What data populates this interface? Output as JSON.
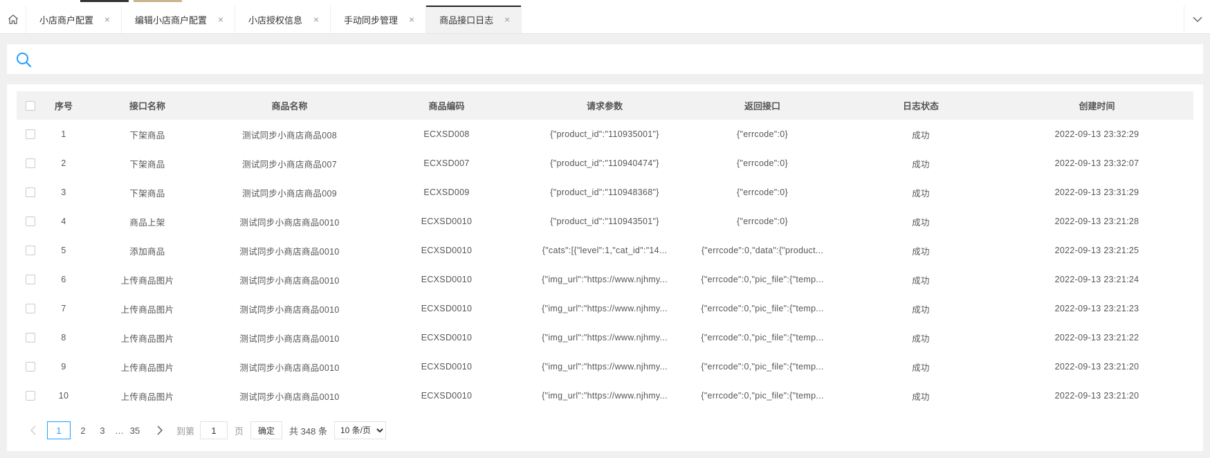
{
  "tabs": [
    {
      "label": "小店商户配置",
      "close": "×",
      "active": false
    },
    {
      "label": "编辑小店商户配置",
      "close": "×",
      "active": false
    },
    {
      "label": "小店授权信息",
      "close": "×",
      "active": false
    },
    {
      "label": "手动同步管理",
      "close": "×",
      "active": false
    },
    {
      "label": "商品接口日志",
      "close": "×",
      "active": true
    }
  ],
  "icons": {
    "home": "home-icon",
    "more": "chevron-down-icon",
    "search": "search-icon",
    "prev": "chevron-left-icon",
    "next": "chevron-right-icon"
  },
  "colors": {
    "accent": "#1e9fff",
    "active_tab_line": "#222222"
  },
  "table": {
    "headers": [
      "序号",
      "接口名称",
      "商品名称",
      "商品编码",
      "请求参数",
      "返回接口",
      "日志状态",
      "创建时间"
    ],
    "rows": [
      [
        "1",
        "下架商品",
        "测试同步小商店商品008",
        "ECXSD008",
        "{\"product_id\":\"110935001\"}",
        "{\"errcode\":0}",
        "成功",
        "2022-09-13 23:32:29"
      ],
      [
        "2",
        "下架商品",
        "测试同步小商店商品007",
        "ECXSD007",
        "{\"product_id\":\"110940474\"}",
        "{\"errcode\":0}",
        "成功",
        "2022-09-13 23:32:07"
      ],
      [
        "3",
        "下架商品",
        "测试同步小商店商品009",
        "ECXSD009",
        "{\"product_id\":\"110948368\"}",
        "{\"errcode\":0}",
        "成功",
        "2022-09-13 23:31:29"
      ],
      [
        "4",
        "商品上架",
        "测试同步小商店商品0010",
        "ECXSD0010",
        "{\"product_id\":\"110943501\"}",
        "{\"errcode\":0}",
        "成功",
        "2022-09-13 23:21:28"
      ],
      [
        "5",
        "添加商品",
        "测试同步小商店商品0010",
        "ECXSD0010",
        "{\"cats\":[{\"level\":1,\"cat_id\":\"14...",
        "{\"errcode\":0,\"data\":{\"product...",
        "成功",
        "2022-09-13 23:21:25"
      ],
      [
        "6",
        "上传商品图片",
        "测试同步小商店商品0010",
        "ECXSD0010",
        "{\"img_url\":\"https://www.njhmy...",
        "{\"errcode\":0,\"pic_file\":{\"temp...",
        "成功",
        "2022-09-13 23:21:24"
      ],
      [
        "7",
        "上传商品图片",
        "测试同步小商店商品0010",
        "ECXSD0010",
        "{\"img_url\":\"https://www.njhmy...",
        "{\"errcode\":0,\"pic_file\":{\"temp...",
        "成功",
        "2022-09-13 23:21:23"
      ],
      [
        "8",
        "上传商品图片",
        "测试同步小商店商品0010",
        "ECXSD0010",
        "{\"img_url\":\"https://www.njhmy...",
        "{\"errcode\":0,\"pic_file\":{\"temp...",
        "成功",
        "2022-09-13 23:21:22"
      ],
      [
        "9",
        "上传商品图片",
        "测试同步小商店商品0010",
        "ECXSD0010",
        "{\"img_url\":\"https://www.njhmy...",
        "{\"errcode\":0,\"pic_file\":{\"temp...",
        "成功",
        "2022-09-13 23:21:20"
      ],
      [
        "10",
        "上传商品图片",
        "测试同步小商店商品0010",
        "ECXSD0010",
        "{\"img_url\":\"https://www.njhmy...",
        "{\"errcode\":0,\"pic_file\":{\"temp...",
        "成功",
        "2022-09-13 23:21:20"
      ]
    ]
  },
  "pagination": {
    "pages": [
      "1",
      "2",
      "3"
    ],
    "ellipsis": "…",
    "last": "35",
    "goto_label": "到第",
    "page_value": "1",
    "page_unit": "页",
    "confirm_label": "确定",
    "total_text": "共 348 条",
    "page_size": "10 条/页"
  }
}
